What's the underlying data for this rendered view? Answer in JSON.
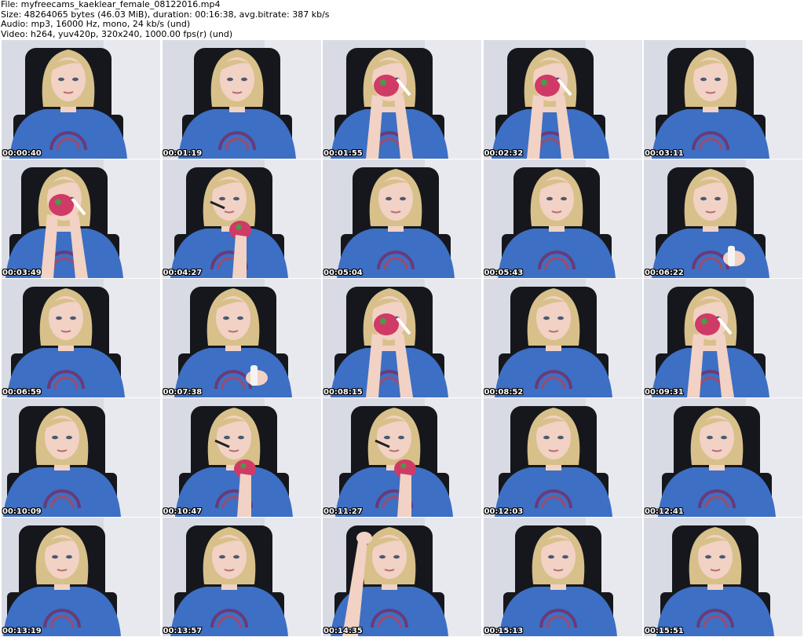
{
  "header": {
    "file": "File: myfreecams_kaeklear_female_08122016.mp4",
    "size": "Size: 48264065 bytes (46.03 MiB), duration: 00:16:38, avg.bitrate: 387 kb/s",
    "audio": "Audio: mp3, 16000 Hz, mono, 24 kb/s (und)",
    "video": "Video: h264, yuv420p, 320x240, 1000.00 fps(r) (und)"
  },
  "thumbnails": [
    {
      "time": "00:00:40"
    },
    {
      "time": "00:01:19"
    },
    {
      "time": "00:01:55"
    },
    {
      "time": "00:02:32"
    },
    {
      "time": "00:03:11"
    },
    {
      "time": "00:03:49"
    },
    {
      "time": "00:04:27"
    },
    {
      "time": "00:05:04"
    },
    {
      "time": "00:05:43"
    },
    {
      "time": "00:06:22"
    },
    {
      "time": "00:06:59"
    },
    {
      "time": "00:07:38"
    },
    {
      "time": "00:08:15"
    },
    {
      "time": "00:08:52"
    },
    {
      "time": "00:09:31"
    },
    {
      "time": "00:10:09"
    },
    {
      "time": "00:10:47"
    },
    {
      "time": "00:11:27"
    },
    {
      "time": "00:12:03"
    },
    {
      "time": "00:12:41"
    },
    {
      "time": "00:13:19"
    },
    {
      "time": "00:13:57"
    },
    {
      "time": "00:14:35"
    },
    {
      "time": "00:15:13"
    },
    {
      "time": "00:15:51"
    }
  ],
  "colors": {
    "background": "#ffffff",
    "wall": "#d9dbe4",
    "shirt": "#3d6fc4",
    "hair": "#d8c08a",
    "skin": "#f1d2c4",
    "chair": "#15171c",
    "stamp_text": "#ffffff"
  }
}
